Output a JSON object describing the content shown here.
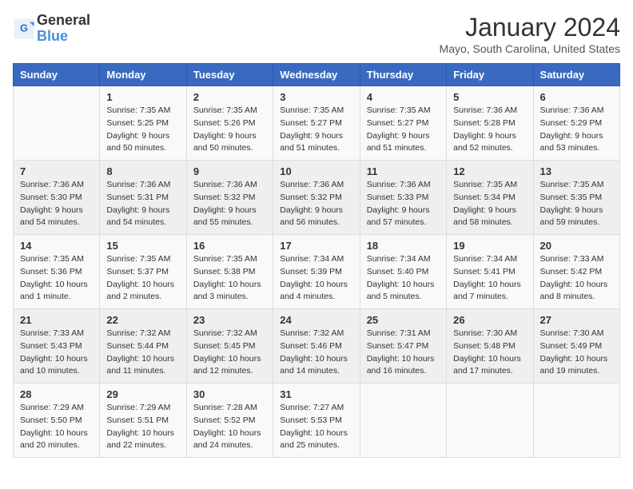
{
  "header": {
    "logo_line1": "General",
    "logo_line2": "Blue",
    "month_title": "January 2024",
    "location": "Mayo, South Carolina, United States"
  },
  "weekdays": [
    "Sunday",
    "Monday",
    "Tuesday",
    "Wednesday",
    "Thursday",
    "Friday",
    "Saturday"
  ],
  "weeks": [
    [
      {
        "day": "",
        "sunrise": "",
        "sunset": "",
        "daylight": ""
      },
      {
        "day": "1",
        "sunrise": "Sunrise: 7:35 AM",
        "sunset": "Sunset: 5:25 PM",
        "daylight": "Daylight: 9 hours and 50 minutes."
      },
      {
        "day": "2",
        "sunrise": "Sunrise: 7:35 AM",
        "sunset": "Sunset: 5:26 PM",
        "daylight": "Daylight: 9 hours and 50 minutes."
      },
      {
        "day": "3",
        "sunrise": "Sunrise: 7:35 AM",
        "sunset": "Sunset: 5:27 PM",
        "daylight": "Daylight: 9 hours and 51 minutes."
      },
      {
        "day": "4",
        "sunrise": "Sunrise: 7:35 AM",
        "sunset": "Sunset: 5:27 PM",
        "daylight": "Daylight: 9 hours and 51 minutes."
      },
      {
        "day": "5",
        "sunrise": "Sunrise: 7:36 AM",
        "sunset": "Sunset: 5:28 PM",
        "daylight": "Daylight: 9 hours and 52 minutes."
      },
      {
        "day": "6",
        "sunrise": "Sunrise: 7:36 AM",
        "sunset": "Sunset: 5:29 PM",
        "daylight": "Daylight: 9 hours and 53 minutes."
      }
    ],
    [
      {
        "day": "7",
        "sunrise": "Sunrise: 7:36 AM",
        "sunset": "Sunset: 5:30 PM",
        "daylight": "Daylight: 9 hours and 54 minutes."
      },
      {
        "day": "8",
        "sunrise": "Sunrise: 7:36 AM",
        "sunset": "Sunset: 5:31 PM",
        "daylight": "Daylight: 9 hours and 54 minutes."
      },
      {
        "day": "9",
        "sunrise": "Sunrise: 7:36 AM",
        "sunset": "Sunset: 5:32 PM",
        "daylight": "Daylight: 9 hours and 55 minutes."
      },
      {
        "day": "10",
        "sunrise": "Sunrise: 7:36 AM",
        "sunset": "Sunset: 5:32 PM",
        "daylight": "Daylight: 9 hours and 56 minutes."
      },
      {
        "day": "11",
        "sunrise": "Sunrise: 7:36 AM",
        "sunset": "Sunset: 5:33 PM",
        "daylight": "Daylight: 9 hours and 57 minutes."
      },
      {
        "day": "12",
        "sunrise": "Sunrise: 7:35 AM",
        "sunset": "Sunset: 5:34 PM",
        "daylight": "Daylight: 9 hours and 58 minutes."
      },
      {
        "day": "13",
        "sunrise": "Sunrise: 7:35 AM",
        "sunset": "Sunset: 5:35 PM",
        "daylight": "Daylight: 9 hours and 59 minutes."
      }
    ],
    [
      {
        "day": "14",
        "sunrise": "Sunrise: 7:35 AM",
        "sunset": "Sunset: 5:36 PM",
        "daylight": "Daylight: 10 hours and 1 minute."
      },
      {
        "day": "15",
        "sunrise": "Sunrise: 7:35 AM",
        "sunset": "Sunset: 5:37 PM",
        "daylight": "Daylight: 10 hours and 2 minutes."
      },
      {
        "day": "16",
        "sunrise": "Sunrise: 7:35 AM",
        "sunset": "Sunset: 5:38 PM",
        "daylight": "Daylight: 10 hours and 3 minutes."
      },
      {
        "day": "17",
        "sunrise": "Sunrise: 7:34 AM",
        "sunset": "Sunset: 5:39 PM",
        "daylight": "Daylight: 10 hours and 4 minutes."
      },
      {
        "day": "18",
        "sunrise": "Sunrise: 7:34 AM",
        "sunset": "Sunset: 5:40 PM",
        "daylight": "Daylight: 10 hours and 5 minutes."
      },
      {
        "day": "19",
        "sunrise": "Sunrise: 7:34 AM",
        "sunset": "Sunset: 5:41 PM",
        "daylight": "Daylight: 10 hours and 7 minutes."
      },
      {
        "day": "20",
        "sunrise": "Sunrise: 7:33 AM",
        "sunset": "Sunset: 5:42 PM",
        "daylight": "Daylight: 10 hours and 8 minutes."
      }
    ],
    [
      {
        "day": "21",
        "sunrise": "Sunrise: 7:33 AM",
        "sunset": "Sunset: 5:43 PM",
        "daylight": "Daylight: 10 hours and 10 minutes."
      },
      {
        "day": "22",
        "sunrise": "Sunrise: 7:32 AM",
        "sunset": "Sunset: 5:44 PM",
        "daylight": "Daylight: 10 hours and 11 minutes."
      },
      {
        "day": "23",
        "sunrise": "Sunrise: 7:32 AM",
        "sunset": "Sunset: 5:45 PM",
        "daylight": "Daylight: 10 hours and 12 minutes."
      },
      {
        "day": "24",
        "sunrise": "Sunrise: 7:32 AM",
        "sunset": "Sunset: 5:46 PM",
        "daylight": "Daylight: 10 hours and 14 minutes."
      },
      {
        "day": "25",
        "sunrise": "Sunrise: 7:31 AM",
        "sunset": "Sunset: 5:47 PM",
        "daylight": "Daylight: 10 hours and 16 minutes."
      },
      {
        "day": "26",
        "sunrise": "Sunrise: 7:30 AM",
        "sunset": "Sunset: 5:48 PM",
        "daylight": "Daylight: 10 hours and 17 minutes."
      },
      {
        "day": "27",
        "sunrise": "Sunrise: 7:30 AM",
        "sunset": "Sunset: 5:49 PM",
        "daylight": "Daylight: 10 hours and 19 minutes."
      }
    ],
    [
      {
        "day": "28",
        "sunrise": "Sunrise: 7:29 AM",
        "sunset": "Sunset: 5:50 PM",
        "daylight": "Daylight: 10 hours and 20 minutes."
      },
      {
        "day": "29",
        "sunrise": "Sunrise: 7:29 AM",
        "sunset": "Sunset: 5:51 PM",
        "daylight": "Daylight: 10 hours and 22 minutes."
      },
      {
        "day": "30",
        "sunrise": "Sunrise: 7:28 AM",
        "sunset": "Sunset: 5:52 PM",
        "daylight": "Daylight: 10 hours and 24 minutes."
      },
      {
        "day": "31",
        "sunrise": "Sunrise: 7:27 AM",
        "sunset": "Sunset: 5:53 PM",
        "daylight": "Daylight: 10 hours and 25 minutes."
      },
      {
        "day": "",
        "sunrise": "",
        "sunset": "",
        "daylight": ""
      },
      {
        "day": "",
        "sunrise": "",
        "sunset": "",
        "daylight": ""
      },
      {
        "day": "",
        "sunrise": "",
        "sunset": "",
        "daylight": ""
      }
    ]
  ]
}
